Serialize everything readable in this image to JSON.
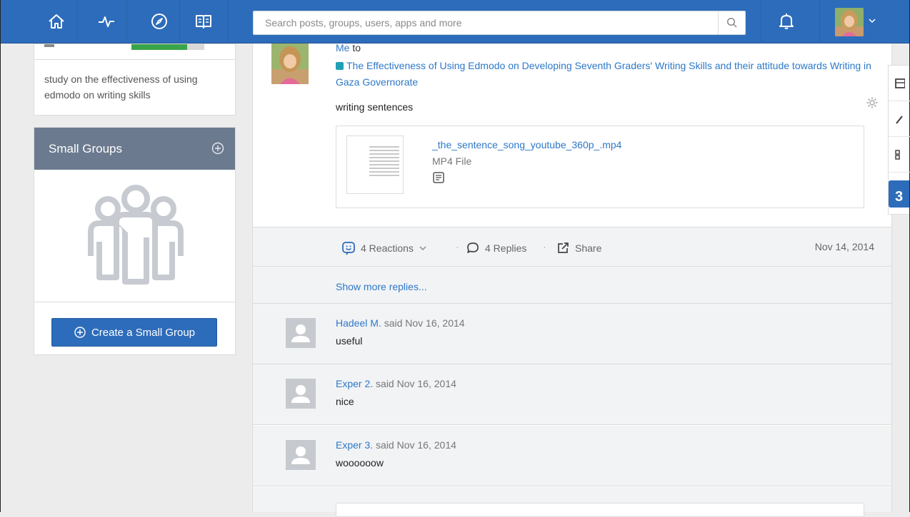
{
  "nav": {
    "icons": [
      "home-icon",
      "activity-icon",
      "compass-icon",
      "book-icon"
    ],
    "search_placeholder": "Search posts, groups, users, apps and more"
  },
  "colors": {
    "nav_blue": "#2d6cba",
    "link_blue": "#2d78c8",
    "group_teal": "#1fa0b6",
    "header_slate": "#6b7a8e"
  },
  "sidebar": {
    "description": "study on the effectiveness of using edmodo on writing skills",
    "small_groups": {
      "title": "Small Groups",
      "create_label": "Create a Small Group"
    }
  },
  "post": {
    "author": "Me",
    "to_word": "to",
    "group": "The Effectiveness of Using Edmodo on Developing Seventh Graders' Writing Skills and their attitude towards Writing in Gaza Governorate",
    "text": "writing sentences",
    "attachment": {
      "name": "_the_sentence_song_youtube_360p_.mp4",
      "type": "MP4 File"
    },
    "actions": {
      "reactions": "4 Reactions",
      "replies": "4 Replies",
      "share": "Share",
      "date": "Nov 14, 2014"
    },
    "show_more": "Show more replies..."
  },
  "replies": [
    {
      "author": "Hadeel M.",
      "said": "said Nov 16, 2014",
      "text": "useful"
    },
    {
      "author": "Exper 2.",
      "said": "said Nov 16, 2014",
      "text": "nice"
    },
    {
      "author": "Exper 3.",
      "said": "said Nov 16, 2014",
      "text": "woooooow"
    }
  ],
  "rail": {
    "calendar_day": "3"
  }
}
